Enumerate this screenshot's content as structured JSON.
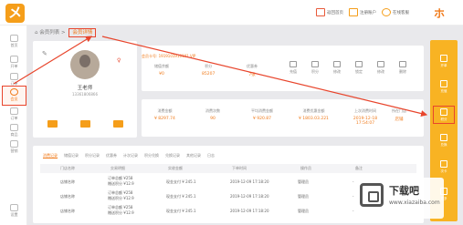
{
  "header": {
    "logo_glyph": "メ",
    "actions": [
      {
        "label": "返回首页",
        "icon": "monitor-icon"
      },
      {
        "label": "注册账户",
        "icon": "user-icon"
      },
      {
        "label": "在线客服",
        "icon": "headset-icon"
      }
    ],
    "avatar_glyph": "ホ"
  },
  "sidebar": {
    "items": [
      {
        "label": "首页",
        "icon": "home-icon"
      },
      {
        "label": "开单",
        "icon": "cart-icon"
      },
      {
        "label": "订单",
        "icon": "order-icon"
      },
      {
        "label": "会员",
        "icon": "member-icon",
        "active": true
      },
      {
        "label": "订单",
        "icon": "list-icon"
      },
      {
        "label": "商品",
        "icon": "goods-icon"
      },
      {
        "label": "营销",
        "icon": "marketing-icon"
      },
      {
        "label": "设置",
        "icon": "gear-icon"
      }
    ]
  },
  "breadcrumb": {
    "parent": "会员列表",
    "current": "会员详情",
    "separator": ">"
  },
  "profile": {
    "name": "王老师",
    "phone": "13361806866"
  },
  "info": {
    "tags": [
      "会员卡号: 1919101910101 VIP",
      "其他标签"
    ],
    "stats": [
      {
        "label": "储值余额",
        "value": "¥0"
      },
      {
        "label": "积分",
        "value": "85207"
      },
      {
        "label": "优惠券",
        "value": "7张"
      }
    ],
    "icons": [
      {
        "label": "充值"
      },
      {
        "label": "积分"
      },
      {
        "label": "修改"
      },
      {
        "label": "锁定"
      },
      {
        "label": "修改"
      },
      {
        "label": "删除"
      }
    ]
  },
  "summary": [
    {
      "label": "消费金额",
      "value": "¥ 8297.74"
    },
    {
      "label": "消费次数",
      "value": "90"
    },
    {
      "label": "平均消费金额",
      "value": "¥ 920.87"
    },
    {
      "label": "消费优惠金额",
      "value": "¥ 1803.03.221"
    },
    {
      "label": "上次消费时间",
      "value": "2019-12-18 17:54:07"
    },
    {
      "label": "所在门店",
      "value": "店铺"
    }
  ],
  "tabs": [
    {
      "label": "消费记录",
      "active": true
    },
    {
      "label": "储值记录"
    },
    {
      "label": "积分记录"
    },
    {
      "label": "优惠券"
    },
    {
      "label": "计次记录"
    },
    {
      "label": "积分兑换"
    },
    {
      "label": "兑换记录"
    },
    {
      "label": "其他记录"
    },
    {
      "label": "日志"
    }
  ],
  "table": {
    "columns": [
      "门店名称",
      "交易明细",
      "实收金额",
      "下单时间",
      "操作员",
      "备注"
    ],
    "rows": [
      {
        "store": "店铺名称",
        "detail": [
          "订单总额 ¥258",
          "赠送积分 ¥12.9"
        ],
        "amount": "现金支付 ¥ 245.1",
        "time": "2019-12-09 17:18:20",
        "operator": "管理员",
        "note": "-"
      },
      {
        "store": "店铺名称",
        "detail": [
          "订单总额 ¥258",
          "赠送积分 ¥12.9"
        ],
        "amount": "现金支付 ¥ 245.1",
        "time": "2019-12-09 17:18:20",
        "operator": "管理员",
        "note": "-"
      },
      {
        "store": "店铺名称",
        "detail": [
          "订单总额 ¥258",
          "赠送积分 ¥12.9"
        ],
        "amount": "现金支付 ¥ 245.1",
        "time": "2019-12-09 17:18:20",
        "operator": "管理员",
        "note": "-"
      }
    ]
  },
  "right_panel": {
    "items": [
      {
        "label": "开单"
      },
      {
        "label": "充值"
      },
      {
        "label": "积分",
        "highlighted": true
      },
      {
        "label": "兑换"
      },
      {
        "label": "次卡"
      },
      {
        "label": "更多"
      }
    ]
  },
  "watermark": {
    "title": "下载吧",
    "subtitle": "www.xiazaiba.com"
  },
  "colors": {
    "accent": "#f59e1a",
    "highlight": "#e8452c"
  }
}
